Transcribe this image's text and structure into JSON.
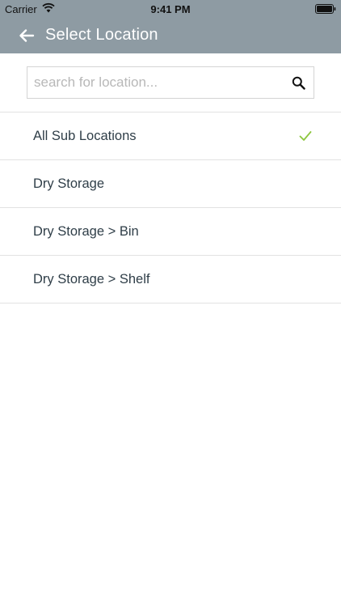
{
  "status_bar": {
    "carrier": "Carrier",
    "time": "9:41 PM",
    "wifi_icon": "wifi-icon",
    "battery_icon": "battery-icon"
  },
  "nav": {
    "back_icon": "arrow-left-icon",
    "title": "Select Location"
  },
  "search": {
    "placeholder": "search for location...",
    "value": "",
    "icon": "search-icon"
  },
  "locations": [
    {
      "label": "All Sub Locations",
      "selected": true
    },
    {
      "label": "Dry Storage",
      "selected": false
    },
    {
      "label": "Dry Storage > Bin",
      "selected": false
    },
    {
      "label": "Dry Storage > Shelf",
      "selected": false
    }
  ],
  "colors": {
    "header": "#8e9ba3",
    "text": "#2f3e48",
    "check": "#8dc63f",
    "divider": "#e2e2e2"
  }
}
